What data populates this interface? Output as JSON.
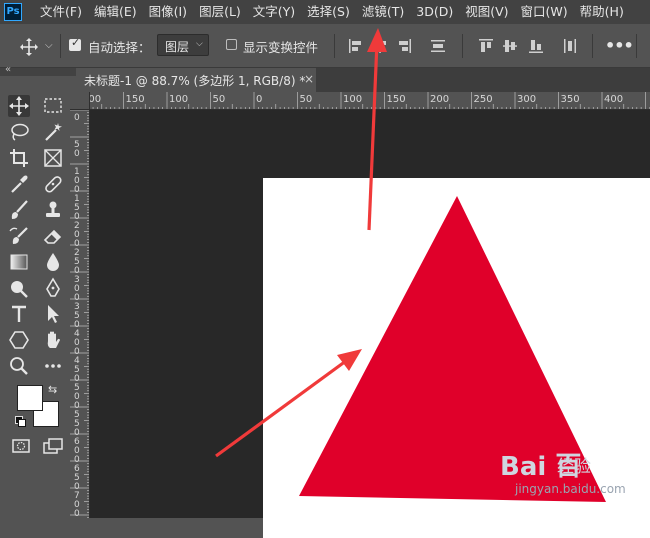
{
  "app": {
    "logo_text": "Ps"
  },
  "menu": [
    "文件(F)",
    "编辑(E)",
    "图像(I)",
    "图层(L)",
    "文字(Y)",
    "选择(S)",
    "滤镜(T)",
    "3D(D)",
    "视图(V)",
    "窗口(W)",
    "帮助(H)"
  ],
  "options_bar": {
    "auto_select_label": "自动选择：",
    "auto_select_checked": true,
    "target_value": "图层",
    "show_transform_label": "显示变换控件",
    "more_label": "•••"
  },
  "document": {
    "tab_title": "未标题-1 @ 88.7% (多边形 1, RGB/8) *",
    "close_glyph": "×",
    "zoom": "88.7%",
    "shape_color": "#e0002a"
  },
  "rulers": {
    "horizontal": [
      "200",
      "150",
      "100",
      "50",
      "0",
      "50",
      "100",
      "150",
      "200",
      "250",
      "300",
      "350",
      "400"
    ],
    "vertical": [
      "0",
      "50",
      "100",
      "150",
      "200",
      "250",
      "300",
      "350",
      "400",
      "450",
      "500",
      "550",
      "600",
      "650",
      "700"
    ]
  },
  "colors": {
    "foreground": "#ffffff",
    "background": "#ffffff",
    "annotation_arrow": "#f03a3a"
  },
  "watermark": {
    "brand": "Bai 百",
    "brand_sub": "经验",
    "url": "jingyan.baidu.com"
  }
}
